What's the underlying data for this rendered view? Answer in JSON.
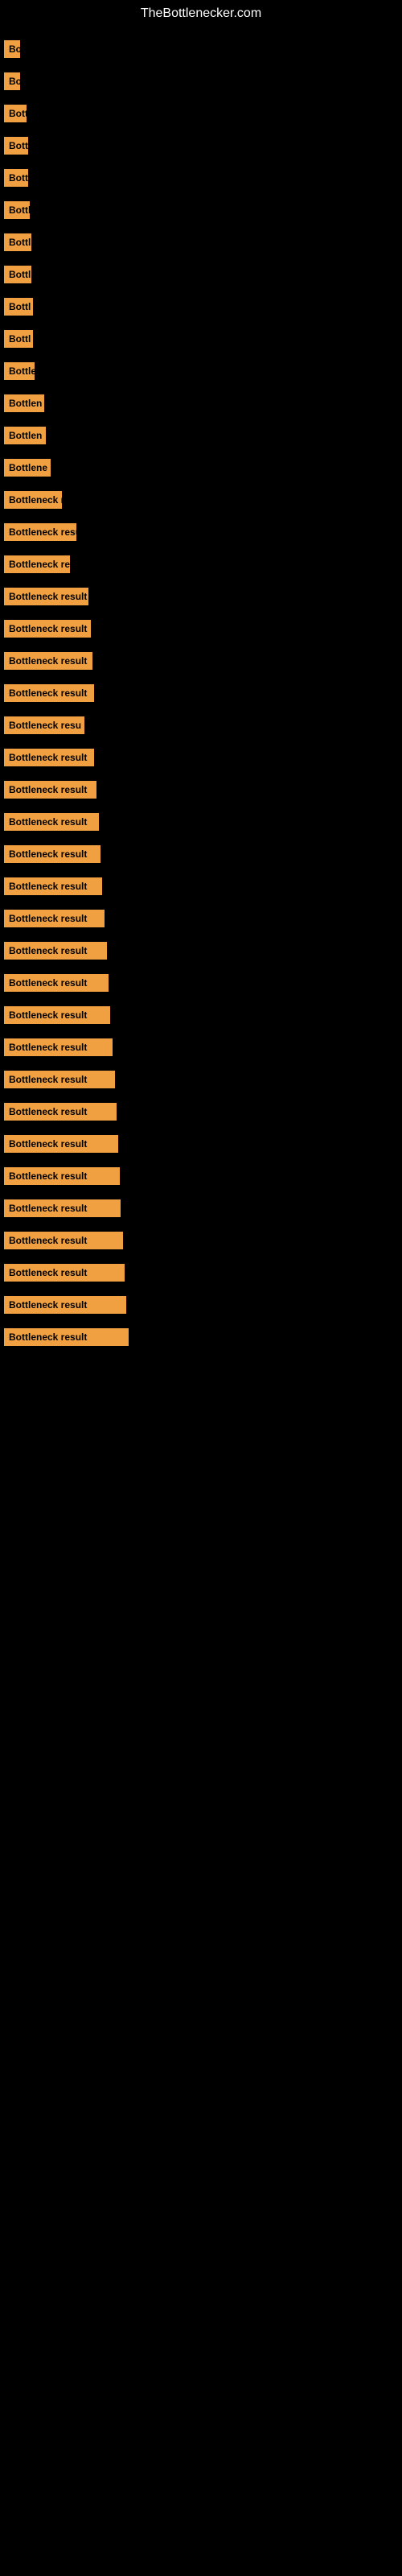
{
  "site": {
    "title": "TheBottlenecker.com"
  },
  "items": [
    {
      "label": "Bo",
      "width": 20
    },
    {
      "label": "Bo",
      "width": 20
    },
    {
      "label": "Bott",
      "width": 28
    },
    {
      "label": "Bott",
      "width": 30
    },
    {
      "label": "Bott",
      "width": 30
    },
    {
      "label": "Bottl",
      "width": 32
    },
    {
      "label": "Bottl",
      "width": 34
    },
    {
      "label": "Bottl",
      "width": 34
    },
    {
      "label": "Bottl",
      "width": 36
    },
    {
      "label": "Bottl",
      "width": 36
    },
    {
      "label": "Bottle",
      "width": 38
    },
    {
      "label": "Bottlen",
      "width": 50
    },
    {
      "label": "Bottlen",
      "width": 52
    },
    {
      "label": "Bottlene",
      "width": 58
    },
    {
      "label": "Bottleneck r",
      "width": 72
    },
    {
      "label": "Bottleneck resu",
      "width": 90
    },
    {
      "label": "Bottleneck re",
      "width": 82
    },
    {
      "label": "Bottleneck result",
      "width": 105
    },
    {
      "label": "Bottleneck result",
      "width": 108
    },
    {
      "label": "Bottleneck result",
      "width": 110
    },
    {
      "label": "Bottleneck result",
      "width": 112
    },
    {
      "label": "Bottleneck resu",
      "width": 100
    },
    {
      "label": "Bottleneck result",
      "width": 112
    },
    {
      "label": "Bottleneck result",
      "width": 115
    },
    {
      "label": "Bottleneck result",
      "width": 118
    },
    {
      "label": "Bottleneck result",
      "width": 120
    },
    {
      "label": "Bottleneck result",
      "width": 122
    },
    {
      "label": "Bottleneck result",
      "width": 125
    },
    {
      "label": "Bottleneck result",
      "width": 128
    },
    {
      "label": "Bottleneck result",
      "width": 130
    },
    {
      "label": "Bottleneck result",
      "width": 132
    },
    {
      "label": "Bottleneck result",
      "width": 135
    },
    {
      "label": "Bottleneck result",
      "width": 138
    },
    {
      "label": "Bottleneck result",
      "width": 140
    },
    {
      "label": "Bottleneck result",
      "width": 142
    },
    {
      "label": "Bottleneck result",
      "width": 144
    },
    {
      "label": "Bottleneck result",
      "width": 145
    },
    {
      "label": "Bottleneck result",
      "width": 148
    },
    {
      "label": "Bottleneck result",
      "width": 150
    },
    {
      "label": "Bottleneck result",
      "width": 152
    },
    {
      "label": "Bottleneck result",
      "width": 155
    }
  ]
}
